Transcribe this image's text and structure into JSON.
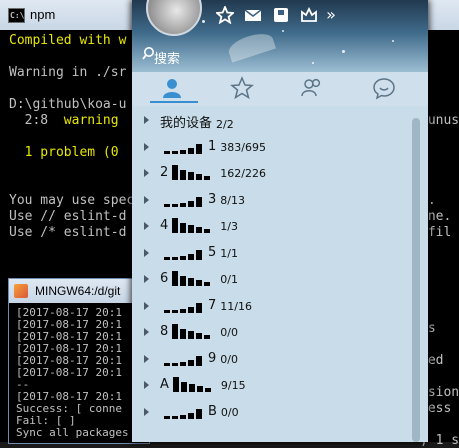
{
  "npm": {
    "title": "npm",
    "icon_text": "C:\\",
    "lines": [
      {
        "text": "Compiled with w",
        "color": "yellow"
      },
      {
        "text": "",
        "color": "gray"
      },
      {
        "text": "Warning in ./sr",
        "color": "gray"
      },
      {
        "text": "",
        "color": "gray"
      },
      {
        "text": "D:\\github\\koa-u",
        "color": "gray"
      },
      {
        "text": "  2:8  warning",
        "color": "mixed"
      },
      {
        "text": "",
        "color": "gray"
      },
      {
        "text": "  1 problem (0",
        "color": "yellow"
      },
      {
        "text": "",
        "color": "gray"
      },
      {
        "text": "",
        "color": "gray"
      },
      {
        "text": "You may use spec",
        "color": "gray"
      },
      {
        "text": "Use // eslint-d",
        "color": "gray"
      },
      {
        "text": "Use /* eslint-d",
        "color": "gray"
      }
    ],
    "right_fragments": [
      {
        "text": "-unus",
        "row": 5
      },
      {
        "text": "s.",
        "row": 10
      },
      {
        "text": "ine.",
        "row": 11
      },
      {
        "text": " fil",
        "row": 12
      },
      {
        "text": "rs",
        "row": 18
      },
      {
        "text": "ted",
        "row": 20
      },
      {
        "text": "rsion",
        "row": 22
      },
      {
        "text": "cess -",
        "row": 23
      },
      {
        "text": ", 1 s",
        "row": 25
      }
    ]
  },
  "mingw": {
    "title": "MINGW64:/d/git",
    "lines": [
      "[2017-08-17 20:1",
      "[2017-08-17 20:1",
      "[2017-08-17 20:1",
      "[2017-08-17 20:1",
      "[2017-08-17 20:1",
      "[2017-08-17 20:1",
      "--",
      "[2017-08-17 20:1",
      "Success: [ conne",
      "Fail: [ ]",
      "Sync all packages"
    ]
  },
  "qq": {
    "search_placeholder": "搜索",
    "header_icons": [
      "star-icon",
      "mail-icon",
      "photo-icon",
      "crown-icon",
      "more-icon"
    ],
    "more_glyph": "»",
    "tabs": [
      "contacts-tab",
      "favorites-tab",
      "groups-tab",
      "chat-tab"
    ],
    "groups": [
      {
        "name": "我的设备",
        "count": "2/2",
        "bars": "none",
        "label_after": ""
      },
      {
        "name": "",
        "count": "383/695",
        "bars": "rising",
        "label_after": "1"
      },
      {
        "name": "2",
        "count": "162/226",
        "bars": "falling",
        "label_after": ""
      },
      {
        "name": "",
        "count": "8/13",
        "bars": "rising",
        "label_after": "3"
      },
      {
        "name": "4",
        "count": "1/3",
        "bars": "falling",
        "label_after": ""
      },
      {
        "name": "",
        "count": "1/1",
        "bars": "rising",
        "label_after": "5"
      },
      {
        "name": "6",
        "count": "0/1",
        "bars": "falling",
        "label_after": ""
      },
      {
        "name": "",
        "count": "11/16",
        "bars": "rising",
        "label_after": "7"
      },
      {
        "name": "8",
        "count": "0/0",
        "bars": "falling",
        "label_after": ""
      },
      {
        "name": "",
        "count": "0/0",
        "bars": "rising",
        "label_after": "9"
      },
      {
        "name": "A",
        "count": "9/15",
        "bars": "falling",
        "label_after": ""
      },
      {
        "name": "",
        "count": "0/0",
        "bars": "rising",
        "label_after": "B"
      }
    ]
  }
}
